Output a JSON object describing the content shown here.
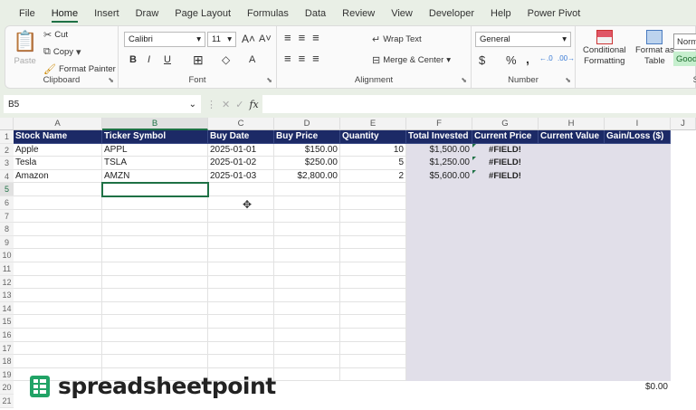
{
  "tabs": [
    "File",
    "Home",
    "Insert",
    "Draw",
    "Page Layout",
    "Formulas",
    "Data",
    "Review",
    "View",
    "Developer",
    "Help",
    "Power Pivot"
  ],
  "active_tab": "Home",
  "ribbon": {
    "clipboard": {
      "paste": "Paste",
      "cut": "Cut",
      "copy": "Copy",
      "format_painter": "Format Painter",
      "label": "Clipboard"
    },
    "font": {
      "name": "Calibri",
      "size": "11",
      "bold": "B",
      "italic": "I",
      "underline": "U",
      "label": "Font"
    },
    "alignment": {
      "wrap_text": "Wrap Text",
      "merge_center": "Merge & Center",
      "label": "Alignment"
    },
    "number": {
      "format": "General",
      "currency": "$",
      "percent": "%",
      "comma": ",",
      "label": "Number"
    },
    "styles": {
      "conditional": "Conditional",
      "conditional2": "Formatting",
      "format_table": "Format as",
      "format_table2": "Table",
      "normal": "Norm",
      "good": "Good",
      "label": "S"
    }
  },
  "formula_bar": {
    "name_box": "B5",
    "fx": "fx",
    "formula": ""
  },
  "columns": [
    "A",
    "B",
    "C",
    "D",
    "E",
    "F",
    "G",
    "H",
    "I",
    "J"
  ],
  "rows": [
    "1",
    "2",
    "3",
    "4",
    "5",
    "6",
    "7",
    "8",
    "9",
    "10",
    "11",
    "12",
    "13",
    "14",
    "15",
    "16",
    "17",
    "18",
    "19",
    "20",
    "21"
  ],
  "headers": [
    "Stock Name",
    "Ticker Symbol",
    "Buy Date",
    "Buy Price",
    "Quantity",
    "Total Invested",
    "Current Price",
    "Current Value",
    "Gain/Loss ($)"
  ],
  "data": [
    [
      "Apple",
      "APPL",
      "2025-01-01",
      "$150.00",
      "10",
      "$1,500.00",
      "#FIELD!",
      "",
      ""
    ],
    [
      "Tesla",
      "TSLA",
      "2025-01-02",
      "$250.00",
      "5",
      "$1,250.00",
      "#FIELD!",
      "",
      ""
    ],
    [
      "Amazon",
      "AMZN",
      "2025-01-03",
      "$2,800.00",
      "2",
      "$5,600.00",
      "#FIELD!",
      "",
      ""
    ]
  ],
  "total_row": {
    "i20": "$0.00"
  },
  "watermark": "spreadsheetpoint",
  "colors": {
    "header_bg": "#1c2a66",
    "shade": "#e1dfe9",
    "accent": "#1e7145"
  }
}
